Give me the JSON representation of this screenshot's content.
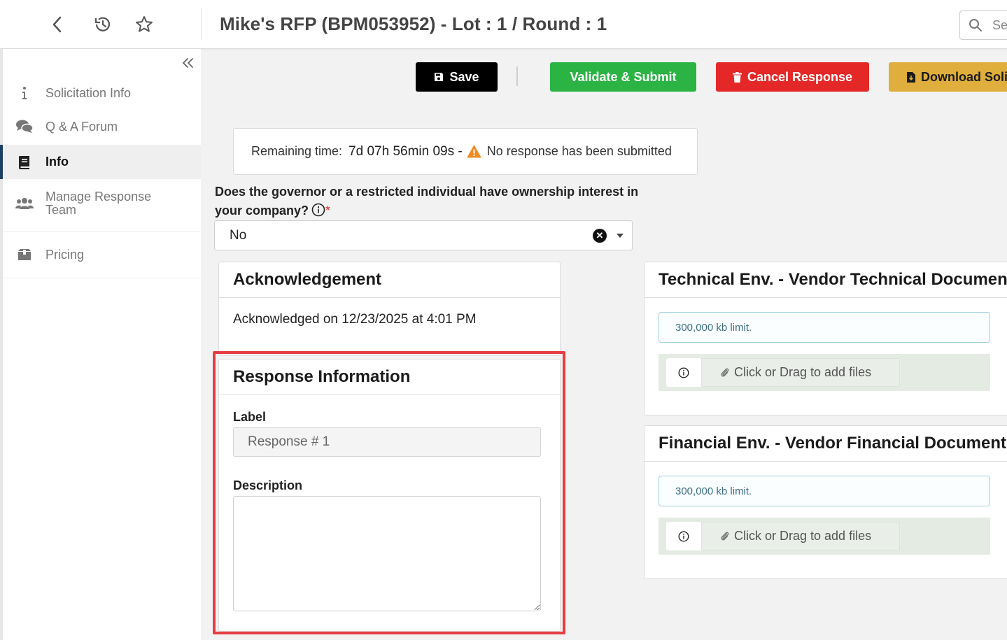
{
  "header": {
    "title": "Mike's RFP (BPM053952) - Lot : 1 / Round : 1",
    "search_placeholder": "Se",
    "icons": [
      "chevron-left-icon",
      "history-icon",
      "star-icon",
      "search-icon"
    ]
  },
  "sidebar": {
    "items": [
      {
        "label": "Solicitation Info",
        "icon": "info-icon"
      },
      {
        "label": "Q & A Forum",
        "icon": "comments-icon"
      },
      {
        "label": "Info",
        "icon": "book-icon",
        "active": true
      },
      {
        "label": "Manage Response Team",
        "icon": "users-icon"
      },
      {
        "label": "Pricing",
        "icon": "box-icon"
      }
    ]
  },
  "actions": {
    "save": "Save",
    "validate": "Validate & Submit",
    "cancel": "Cancel Response",
    "download": "Download Soli"
  },
  "timer": {
    "label": "Remaining time:",
    "value": "7d 07h 56min 09s -",
    "status": "No response has been submitted"
  },
  "question": {
    "text": "Does the governor or a restricted individual have ownership interest in your company?",
    "required_mark": "*",
    "selected": "No"
  },
  "acknowledgement": {
    "title": "Acknowledgement",
    "text": "Acknowledged on 12/23/2025 at 4:01 PM"
  },
  "response_info": {
    "title": "Response Information",
    "label_field": "Label",
    "label_value": "Response # 1",
    "description_field": "Description",
    "description_value": ""
  },
  "technical_env": {
    "title": "Technical Env. - Vendor Technical Documents",
    "limit": "300,000 kb limit.",
    "add_files": "Click or Drag to add files"
  },
  "financial_env": {
    "title": "Financial Env. - Vendor Financial Documents",
    "limit": "300,000 kb limit.",
    "add_files": "Click or Drag to add files"
  },
  "colors": {
    "save": "#000000",
    "validate": "#2bb344",
    "cancel": "#e32827",
    "download": "#dfae3c",
    "highlight": "#e53d43",
    "active_nav": "#1c3f63"
  }
}
